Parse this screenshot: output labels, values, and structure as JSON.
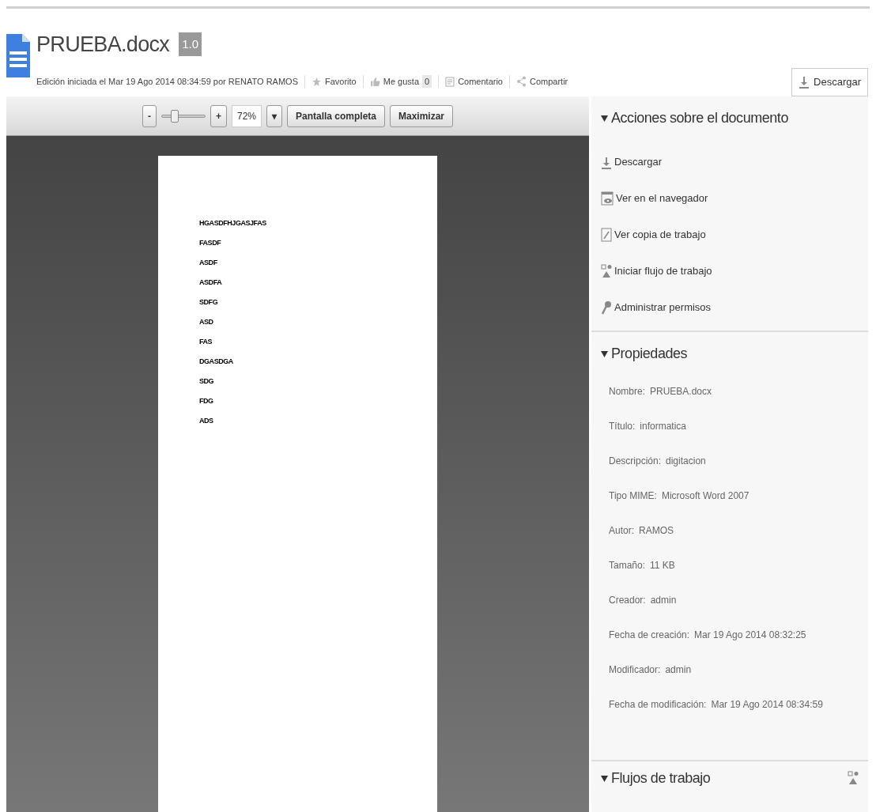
{
  "document": {
    "title": "PRUEBA.docx",
    "version": "1.0",
    "meta": "Edición iniciada el Mar 19 Ago 2014 08:34:59 por RENATO RAMOS",
    "actions": [
      {
        "kind": "favorite",
        "label": "Favorito"
      },
      {
        "kind": "like",
        "label": "Me gusta",
        "count": "0"
      },
      {
        "kind": "comment",
        "label": "Comentario"
      },
      {
        "kind": "share",
        "label": "Compartir"
      }
    ],
    "download_button": "Descargar"
  },
  "viewer": {
    "zoom_out": "-",
    "zoom_in": "+",
    "zoom_slider": {
      "level": 0.3
    },
    "zoom_value": "72%",
    "dropdown": "▾",
    "buttons": [
      "Pantalla completa",
      "Maximizar"
    ],
    "page_lines": [
      "HGASDFHJGASJFAS",
      "FASDF",
      "ASDF",
      "ASDFA",
      "SDFG",
      "ASD",
      "FAS",
      "DGASDGA",
      "SDG",
      "FDG",
      "ADS"
    ]
  },
  "sidebar": {
    "sections": [
      {
        "title": "Acciones sobre el documento",
        "expanded": true,
        "kind": "actions",
        "items": [
          {
            "label": "Descargar"
          },
          {
            "label": "Ver en el navegador"
          },
          {
            "label": "Ver copia de trabajo"
          },
          {
            "label": "Iniciar flujo de trabajo"
          },
          {
            "label": "Administrar permisos"
          }
        ]
      },
      {
        "title": "Propiedades",
        "expanded": true,
        "kind": "properties",
        "items": [
          {
            "label": "Nombre:",
            "value": "PRUEBA.docx"
          },
          {
            "label": "Título:",
            "value": "informatica"
          },
          {
            "label": "Descripción:",
            "value": "digitacion"
          },
          {
            "label": "Tipo MIME:",
            "value": "Microsoft Word 2007"
          },
          {
            "label": "Autor:",
            "value": "RAMOS"
          },
          {
            "label": "Tamaño:",
            "value": "11 KB"
          },
          {
            "label": "Creador:",
            "value": "admin"
          },
          {
            "label": "Fecha de creación:",
            "value": "Mar 19 Ago 2014 08:32:25"
          },
          {
            "label": "Modificador:",
            "value": "admin"
          },
          {
            "label": "Fecha de modificación:",
            "value": "Mar 19 Ago 2014 08:34:59"
          }
        ]
      },
      {
        "title": "Flujos de trabajo",
        "expanded": true,
        "kind": "workflows"
      }
    ]
  }
}
